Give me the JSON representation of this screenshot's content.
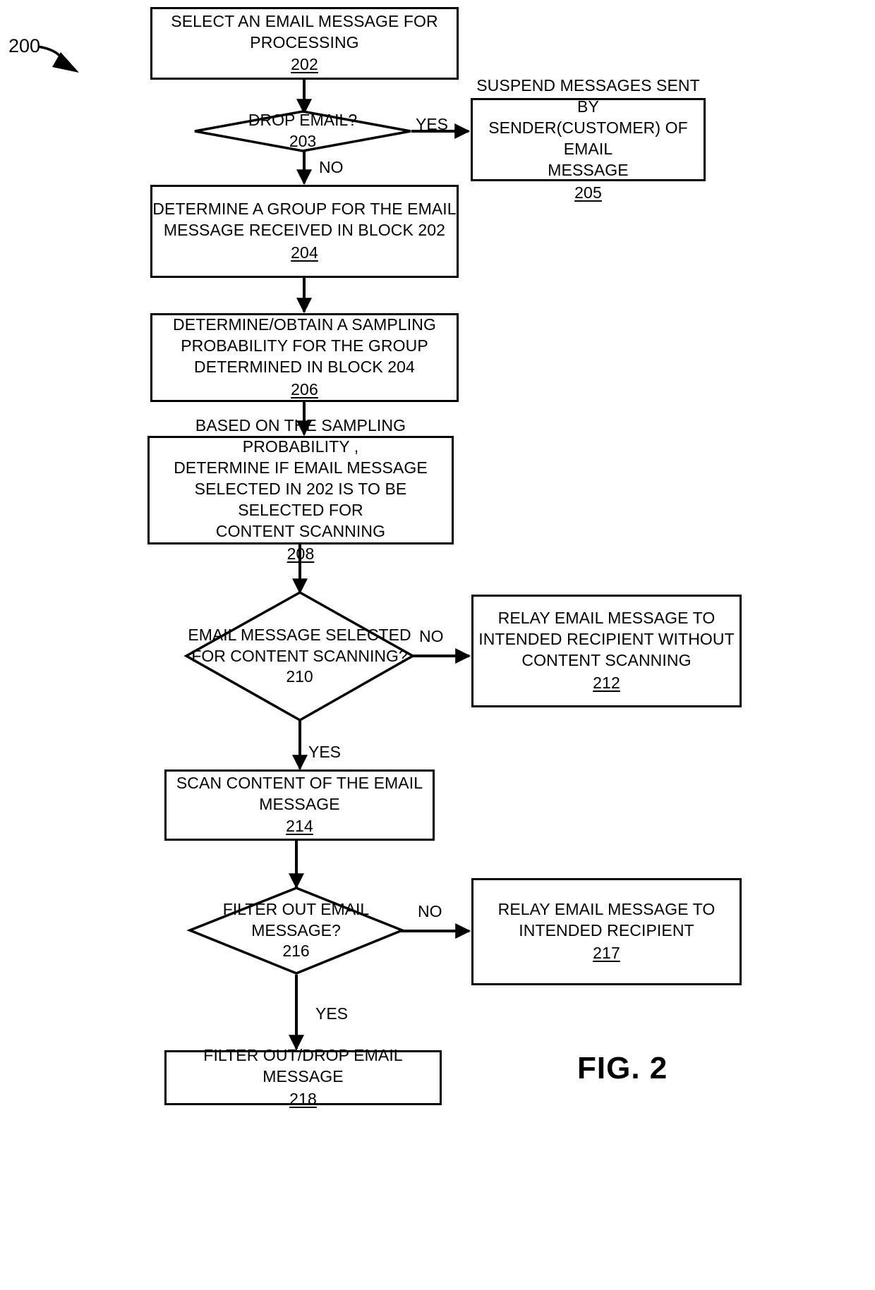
{
  "figure": {
    "caption": "FIG. 2",
    "flow_ref": "200"
  },
  "nodes": {
    "n202": {
      "text": "SELECT AN EMAIL MESSAGE FOR\nPROCESSING",
      "ref": "202",
      "shape": "process"
    },
    "n203": {
      "text": "DROP EMAIL?",
      "ref": "203",
      "shape": "decision"
    },
    "n205": {
      "text": "SUSPEND MESSAGES SENT  BY\nSENDER(CUSTOMER) OF EMAIL\nMESSAGE",
      "ref": "205",
      "shape": "process"
    },
    "n204": {
      "text": "DETERMINE A GROUP FOR THE EMAIL\nMESSAGE RECEIVED IN BLOCK 202",
      "ref": "204",
      "shape": "process"
    },
    "n206": {
      "text": "DETERMINE/OBTAIN A SAMPLING\nPROBABILITY FOR THE GROUP\nDETERMINED IN BLOCK 204",
      "ref": "206",
      "shape": "process"
    },
    "n208": {
      "text": "BASED ON THE SAMPLING PROBABILITY ,\nDETERMINE IF EMAIL MESSAGE\nSELECTED IN 202 IS TO BE SELECTED FOR\nCONTENT SCANNING",
      "ref": "208",
      "shape": "process"
    },
    "n210": {
      "text": "EMAIL\nMESSAGE\nSELECTED FOR\nCONTENT SCANNING?",
      "ref": "210",
      "shape": "decision"
    },
    "n212": {
      "text": "RELAY EMAIL MESSAGE TO\nINTENDED RECIPIENT WITHOUT\nCONTENT SCANNING",
      "ref": "212",
      "shape": "process"
    },
    "n214": {
      "text": "SCAN CONTENT OF THE EMAIL\nMESSAGE",
      "ref": "214",
      "shape": "process"
    },
    "n216": {
      "text": "FILTER OUT EMAIL\nMESSAGE?",
      "ref": "216",
      "shape": "decision"
    },
    "n217": {
      "text": "RELAY EMAIL MESSAGE TO\nINTENDED RECIPIENT",
      "ref": "217",
      "shape": "process"
    },
    "n218": {
      "text": "FILTER OUT/DROP EMAIL MESSAGE",
      "ref": "218",
      "shape": "process"
    }
  },
  "edges": {
    "e203_yes": "YES",
    "e203_no": "NO",
    "e210_no": "NO",
    "e210_yes": "YES",
    "e216_no": "NO",
    "e216_yes": "YES"
  },
  "style": {
    "stroke": "#000000",
    "background": "#ffffff"
  }
}
